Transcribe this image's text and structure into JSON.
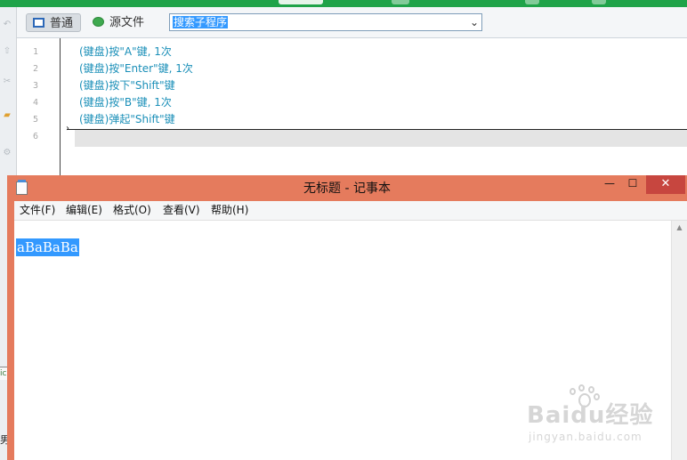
{
  "editor": {
    "modes": {
      "normal": "普通",
      "source": "源文件"
    },
    "search_value": "搜索子程序",
    "line_numbers": [
      "1",
      "2",
      "3",
      "4",
      "5",
      "6"
    ],
    "lines": [
      "(键盘)按\"A\"键, 1次",
      "(键盘)按\"Enter\"键, 1次",
      "(键盘)按下\"Shift\"键",
      "(键盘)按\"B\"键, 1次",
      "(键盘)弹起\"Shift\"键"
    ],
    "side_fragments": {
      "a": "ic",
      "b": "男"
    }
  },
  "notepad": {
    "title": "无标题 - 记事本",
    "controls": {
      "minimize": "—",
      "maximize": "☐",
      "close": "✕"
    },
    "menu": [
      "文件(F)",
      "编辑(E)",
      "格式(O)",
      "查看(V)",
      "帮助(H)"
    ],
    "content": "aBaBaBa"
  },
  "watermark": {
    "logo": "Baidu经验",
    "url": "jingyan.baidu.com"
  },
  "colors": {
    "brand_green": "#1fa349",
    "code_text": "#1a8fb8",
    "selection": "#3399ff",
    "notepad_frame": "#e57b5d",
    "close_button": "#c7463f"
  },
  "icons": [
    "undo-icon",
    "up-icon",
    "cut-icon",
    "paste-icon",
    "notepad-app-icon",
    "scroll-up-icon",
    "paw-icon"
  ]
}
